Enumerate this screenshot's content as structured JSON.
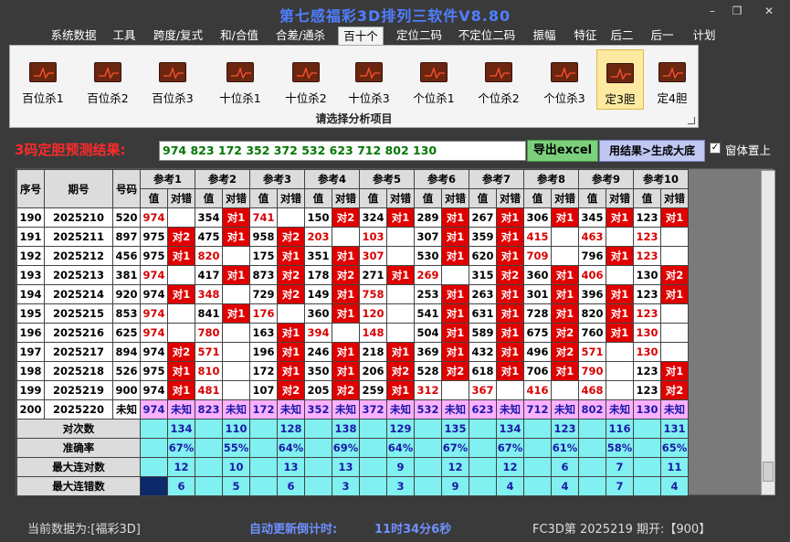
{
  "window": {
    "title": "第七感福彩3D排列三软件V8.80",
    "controls": [
      "–",
      "❐",
      "✕"
    ]
  },
  "menu": [
    {
      "label": "系统数据",
      "active": false
    },
    {
      "label": "工具",
      "active": false
    },
    {
      "label": "跨度/复式",
      "active": false
    },
    {
      "label": "和/合值",
      "active": false
    },
    {
      "label": "合差/通杀",
      "active": false
    },
    {
      "label": "百十个",
      "active": true
    },
    {
      "label": "定位二码",
      "active": false
    },
    {
      "label": "不定位二码",
      "active": false
    },
    {
      "label": "振幅",
      "active": false
    },
    {
      "label": "特征",
      "active": false
    },
    {
      "label": "后二",
      "active": false
    },
    {
      "label": "后一",
      "active": false
    },
    {
      "label": "计划",
      "active": false
    }
  ],
  "ribbon": {
    "buttons": [
      {
        "label": "百位杀1",
        "selected": false
      },
      {
        "label": "百位杀2",
        "selected": false
      },
      {
        "label": "百位杀3",
        "selected": false
      },
      {
        "label": "十位杀1",
        "selected": false
      },
      {
        "label": "十位杀2",
        "selected": false
      },
      {
        "label": "十位杀3",
        "selected": false
      },
      {
        "label": "个位杀1",
        "selected": false
      },
      {
        "label": "个位杀2",
        "selected": false
      },
      {
        "label": "个位杀3",
        "selected": false
      },
      {
        "label": "定3胆",
        "selected": true
      },
      {
        "label": "定4胆",
        "selected": false
      }
    ],
    "caption": "请选择分析项目"
  },
  "prediction": {
    "label": "3码定胆预测结果:",
    "value": "974 823 172 352 372 532 623 712 802 130",
    "export_label": "导出excel",
    "generate_label": "用结果>生成大底",
    "topmost_checked": "✓",
    "topmost_label": "窗体置上"
  },
  "colors": {
    "accent": "#4f7fff",
    "hit": "#e00000",
    "predict_row": "#ffb0ff",
    "stats": "#80f0f0"
  },
  "grid": {
    "headers": {
      "seq": "序号",
      "issue": "期号",
      "number": "号码",
      "value": "值",
      "check": "对错"
    },
    "refs": [
      "参考1",
      "参考2",
      "参考3",
      "参考4",
      "参考5",
      "参考6",
      "参考7",
      "参考8",
      "参考9",
      "参考10"
    ],
    "rows": [
      {
        "seq": "190",
        "issue": "2025210",
        "num": "520",
        "cells": [
          [
            "974",
            "",
            "r"
          ],
          [
            "354",
            "对1",
            ""
          ],
          [
            "741",
            "",
            "r"
          ],
          [
            "150",
            "对2",
            ""
          ],
          [
            "324",
            "对1",
            ""
          ],
          [
            "289",
            "对1",
            ""
          ],
          [
            "267",
            "对1",
            ""
          ],
          [
            "306",
            "对1",
            ""
          ],
          [
            "345",
            "对1",
            ""
          ],
          [
            "123",
            "对1",
            ""
          ]
        ]
      },
      {
        "seq": "191",
        "issue": "2025211",
        "num": "897",
        "cells": [
          [
            "975",
            "对2",
            ""
          ],
          [
            "475",
            "对1",
            ""
          ],
          [
            "958",
            "对2",
            ""
          ],
          [
            "203",
            "",
            "r"
          ],
          [
            "103",
            "",
            "r"
          ],
          [
            "307",
            "对1",
            ""
          ],
          [
            "359",
            "对1",
            ""
          ],
          [
            "415",
            "",
            "r"
          ],
          [
            "463",
            "",
            "r"
          ],
          [
            "123",
            "",
            "r"
          ]
        ]
      },
      {
        "seq": "192",
        "issue": "2025212",
        "num": "456",
        "cells": [
          [
            "975",
            "对1",
            ""
          ],
          [
            "820",
            "",
            "r"
          ],
          [
            "175",
            "对1",
            ""
          ],
          [
            "351",
            "对1",
            ""
          ],
          [
            "307",
            "",
            "r"
          ],
          [
            "530",
            "对1",
            ""
          ],
          [
            "620",
            "对1",
            ""
          ],
          [
            "709",
            "",
            "r"
          ],
          [
            "796",
            "对1",
            ""
          ],
          [
            "123",
            "",
            "r"
          ]
        ]
      },
      {
        "seq": "193",
        "issue": "2025213",
        "num": "381",
        "cells": [
          [
            "974",
            "",
            "r"
          ],
          [
            "417",
            "对1",
            ""
          ],
          [
            "873",
            "对2",
            ""
          ],
          [
            "178",
            "对2",
            ""
          ],
          [
            "271",
            "对1",
            ""
          ],
          [
            "269",
            "",
            "r"
          ],
          [
            "315",
            "对2",
            ""
          ],
          [
            "360",
            "对1",
            ""
          ],
          [
            "406",
            "",
            "r"
          ],
          [
            "130",
            "对2",
            ""
          ]
        ]
      },
      {
        "seq": "194",
        "issue": "2025214",
        "num": "920",
        "cells": [
          [
            "974",
            "对1",
            ""
          ],
          [
            "348",
            "",
            "r"
          ],
          [
            "729",
            "对2",
            ""
          ],
          [
            "149",
            "对1",
            ""
          ],
          [
            "758",
            "",
            "r"
          ],
          [
            "253",
            "对1",
            ""
          ],
          [
            "263",
            "对1",
            ""
          ],
          [
            "301",
            "对1",
            ""
          ],
          [
            "396",
            "对1",
            ""
          ],
          [
            "123",
            "对1",
            ""
          ]
        ]
      },
      {
        "seq": "195",
        "issue": "2025215",
        "num": "853",
        "cells": [
          [
            "974",
            "",
            "r"
          ],
          [
            "841",
            "对1",
            ""
          ],
          [
            "176",
            "",
            "r"
          ],
          [
            "360",
            "对1",
            ""
          ],
          [
            "120",
            "",
            "r"
          ],
          [
            "541",
            "对1",
            ""
          ],
          [
            "631",
            "对1",
            ""
          ],
          [
            "728",
            "对1",
            ""
          ],
          [
            "820",
            "对1",
            ""
          ],
          [
            "123",
            "",
            "r"
          ]
        ]
      },
      {
        "seq": "196",
        "issue": "2025216",
        "num": "625",
        "cells": [
          [
            "974",
            "",
            "r"
          ],
          [
            "780",
            "",
            "r"
          ],
          [
            "163",
            "对1",
            ""
          ],
          [
            "394",
            "",
            "r"
          ],
          [
            "148",
            "",
            "r"
          ],
          [
            "504",
            "对1",
            ""
          ],
          [
            "589",
            "对1",
            ""
          ],
          [
            "675",
            "对2",
            ""
          ],
          [
            "760",
            "对1",
            ""
          ],
          [
            "130",
            "",
            "r"
          ]
        ]
      },
      {
        "seq": "197",
        "issue": "2025217",
        "num": "894",
        "cells": [
          [
            "974",
            "对2",
            ""
          ],
          [
            "571",
            "",
            "r"
          ],
          [
            "196",
            "对1",
            ""
          ],
          [
            "246",
            "对1",
            ""
          ],
          [
            "218",
            "对1",
            ""
          ],
          [
            "369",
            "对1",
            ""
          ],
          [
            "432",
            "对1",
            ""
          ],
          [
            "496",
            "对2",
            ""
          ],
          [
            "571",
            "",
            "r"
          ],
          [
            "130",
            "",
            "r"
          ]
        ]
      },
      {
        "seq": "198",
        "issue": "2025218",
        "num": "526",
        "cells": [
          [
            "975",
            "对1",
            ""
          ],
          [
            "810",
            "",
            "r"
          ],
          [
            "172",
            "对1",
            ""
          ],
          [
            "350",
            "对1",
            ""
          ],
          [
            "206",
            "对2",
            ""
          ],
          [
            "528",
            "对2",
            ""
          ],
          [
            "618",
            "对1",
            ""
          ],
          [
            "706",
            "对1",
            ""
          ],
          [
            "790",
            "",
            "r"
          ],
          [
            "123",
            "对1",
            ""
          ]
        ]
      },
      {
        "seq": "199",
        "issue": "2025219",
        "num": "900",
        "cells": [
          [
            "974",
            "对1",
            ""
          ],
          [
            "481",
            "",
            "r"
          ],
          [
            "107",
            "对2",
            ""
          ],
          [
            "205",
            "对2",
            ""
          ],
          [
            "259",
            "对1",
            ""
          ],
          [
            "312",
            "",
            "r"
          ],
          [
            "367",
            "",
            "r"
          ],
          [
            "416",
            "",
            "r"
          ],
          [
            "468",
            "",
            "r"
          ],
          [
            "123",
            "对2",
            ""
          ]
        ]
      }
    ],
    "predict_row": {
      "seq": "200",
      "issue": "2025220",
      "num": "未知",
      "cells": [
        [
          "974",
          "未知"
        ],
        [
          "823",
          "未知"
        ],
        [
          "172",
          "未知"
        ],
        [
          "352",
          "未知"
        ],
        [
          "372",
          "未知"
        ],
        [
          "532",
          "未知"
        ],
        [
          "623",
          "未知"
        ],
        [
          "712",
          "未知"
        ],
        [
          "802",
          "未知"
        ],
        [
          "130",
          "未知"
        ]
      ]
    },
    "stats": [
      {
        "label": "对次数",
        "values": [
          "134",
          "110",
          "128",
          "138",
          "129",
          "135",
          "134",
          "123",
          "116",
          "131"
        ]
      },
      {
        "label": "准确率",
        "values": [
          "67%",
          "55%",
          "64%",
          "69%",
          "64%",
          "67%",
          "67%",
          "61%",
          "58%",
          "65%"
        ]
      },
      {
        "label": "最大连对数",
        "values": [
          "12",
          "10",
          "13",
          "13",
          "9",
          "12",
          "12",
          "6",
          "7",
          "11"
        ]
      },
      {
        "label": "最大连错数",
        "values": [
          "6",
          "5",
          "6",
          "3",
          "3",
          "9",
          "4",
          "4",
          "7",
          "4"
        ]
      }
    ]
  },
  "status": {
    "current_label": "当前数据为:[福彩3D]",
    "countdown_label": "自动更新倒计时:",
    "countdown_value": "11时34分6秒",
    "issue_info": "FC3D第 2025219 期开:【900】"
  }
}
